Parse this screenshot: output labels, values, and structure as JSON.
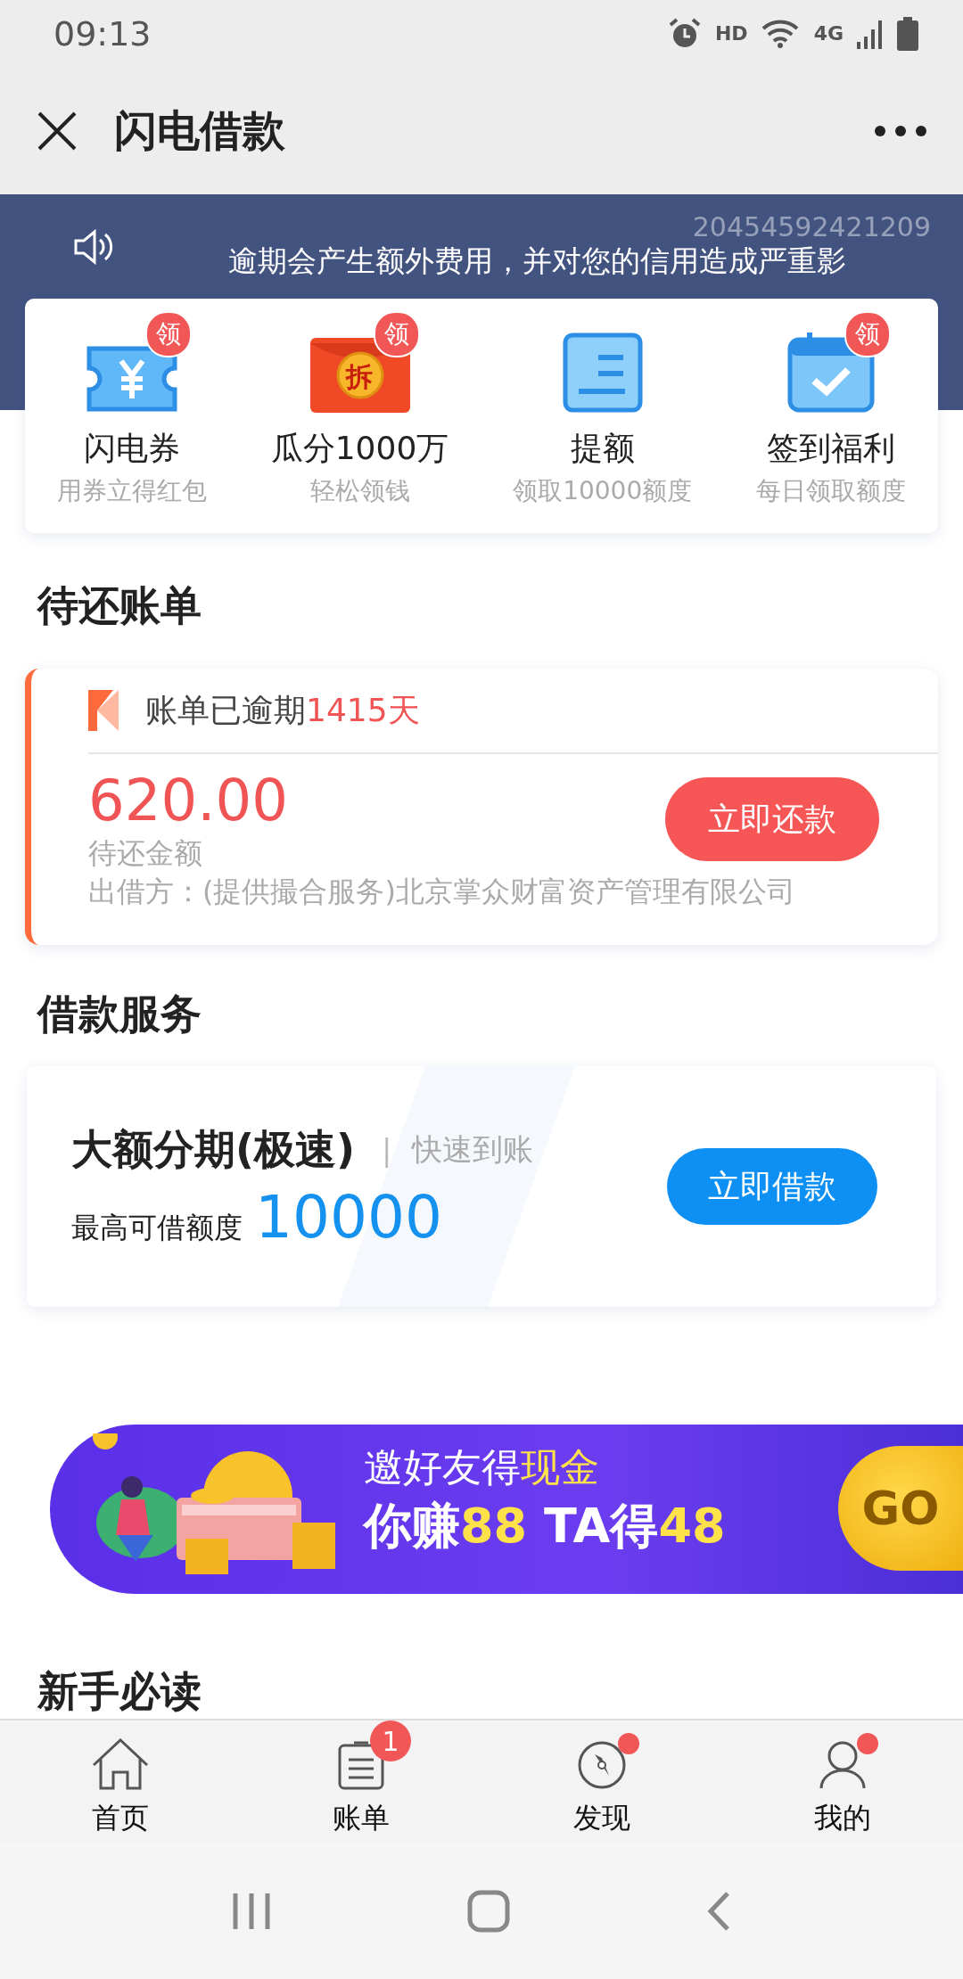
{
  "status_bar": {
    "time": "09:13",
    "hd": "HD",
    "network": "4G"
  },
  "header": {
    "title": "闪电借款"
  },
  "notice": {
    "overlay_id": "20454592421209",
    "text": "逾期会产生额外费用，并对您的信用造成严重影"
  },
  "shortcuts": [
    {
      "kind": "ticket",
      "label": "闪电券",
      "sublabel": "用券立得红包",
      "badge": "领"
    },
    {
      "kind": "red_packet",
      "label": "瓜分1000万",
      "sublabel": "轻松领钱",
      "badge": "领",
      "icon_text": "拆"
    },
    {
      "kind": "form",
      "label": "提额",
      "sublabel": "领取10000额度"
    },
    {
      "kind": "calendar",
      "label": "签到福利",
      "sublabel": "每日领取额度",
      "badge": "领"
    }
  ],
  "bills": {
    "heading": "待还账单",
    "status": [
      {
        "text": "账单已逾期",
        "highlight": false
      },
      {
        "text": "1415天",
        "highlight": true
      }
    ],
    "amount": "620.00",
    "amount_label": "待还金额",
    "lender": "出借方：(提供撮合服务)北京掌众财富资产管理有限公司",
    "button": "立即还款"
  },
  "loans": {
    "heading": "借款服务",
    "title": "大额分期(极速)",
    "separator": "|",
    "tag": "快速到账",
    "limit_label": "最高可借额度",
    "limit": "10000",
    "button": "立即借款"
  },
  "promo": {
    "headline": [
      {
        "text": "邀好友得",
        "highlight": false
      },
      {
        "text": "现金",
        "highlight": true
      }
    ],
    "reward": [
      {
        "text": "你赚",
        "highlight": false
      },
      {
        "text": "88",
        "highlight": true
      },
      {
        "text": " TA得",
        "highlight": false
      },
      {
        "text": "48",
        "highlight": true
      }
    ],
    "button": "GO"
  },
  "guide": {
    "heading": "新手必读"
  },
  "tabs": [
    {
      "kind": "home",
      "label": "首页",
      "dot": false
    },
    {
      "kind": "bill",
      "label": "账单",
      "badge": "1",
      "dot": false
    },
    {
      "kind": "compass",
      "label": "发现",
      "dot": true
    },
    {
      "kind": "person",
      "label": "我的",
      "dot": true
    }
  ]
}
